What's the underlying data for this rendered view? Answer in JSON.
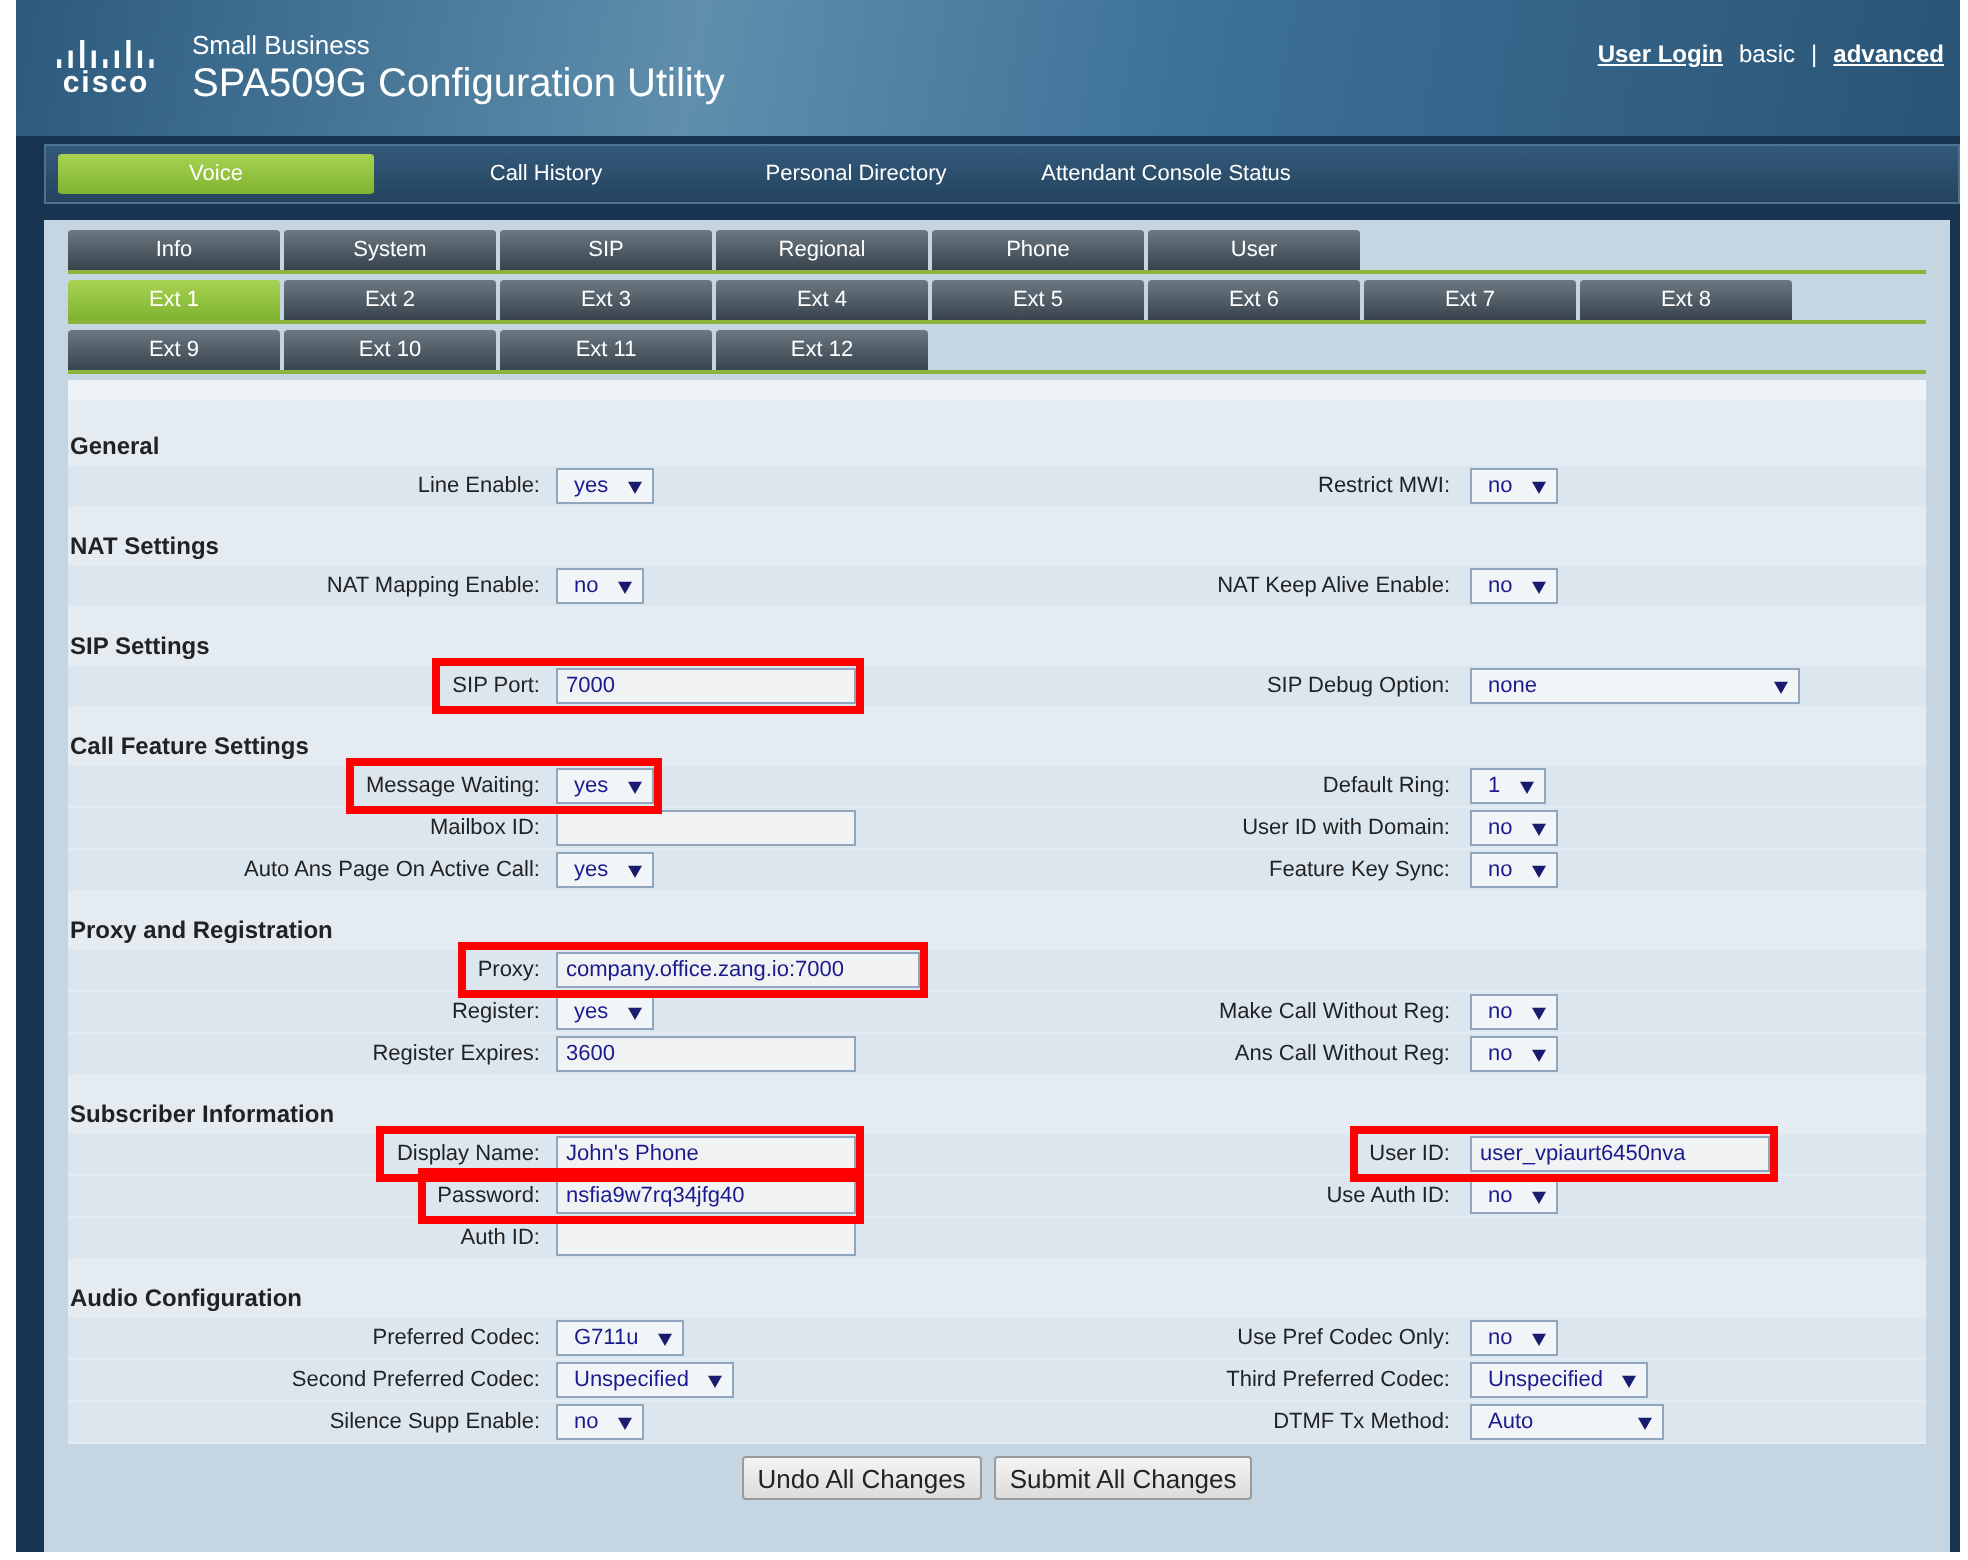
{
  "header": {
    "logo_text": "cisco",
    "brand": "Small Business",
    "title": "SPA509G Configuration Utility",
    "links": [
      {
        "kind": "link",
        "text": "User Login"
      },
      {
        "kind": "plain",
        "text": "basic"
      },
      {
        "kind": "separator",
        "text": "|"
      },
      {
        "kind": "link",
        "text": "advanced"
      }
    ]
  },
  "nav_tabs": [
    {
      "label": "Voice",
      "selected": true
    },
    {
      "label": "Call History",
      "selected": false
    },
    {
      "label": "Personal Directory",
      "selected": false
    },
    {
      "label": "Attendant Console Status",
      "selected": false
    }
  ],
  "tab_rows": [
    [
      {
        "label": "Info",
        "selected": false
      },
      {
        "label": "System",
        "selected": false
      },
      {
        "label": "SIP",
        "selected": false
      },
      {
        "label": "Regional",
        "selected": false
      },
      {
        "label": "Phone",
        "selected": false
      },
      {
        "label": "User",
        "selected": false
      }
    ],
    [
      {
        "label": "Ext 1",
        "selected": true
      },
      {
        "label": "Ext 2",
        "selected": false
      },
      {
        "label": "Ext 3",
        "selected": false
      },
      {
        "label": "Ext 4",
        "selected": false
      },
      {
        "label": "Ext 5",
        "selected": false
      },
      {
        "label": "Ext 6",
        "selected": false
      },
      {
        "label": "Ext 7",
        "selected": false
      },
      {
        "label": "Ext 8",
        "selected": false
      }
    ],
    [
      {
        "label": "Ext 9",
        "selected": false
      },
      {
        "label": "Ext 10",
        "selected": false
      },
      {
        "label": "Ext 11",
        "selected": false
      },
      {
        "label": "Ext 12",
        "selected": false
      }
    ]
  ],
  "sections": [
    {
      "title": "General",
      "rows": [
        {
          "left": {
            "label": "Line Enable:",
            "kind": "select",
            "value": "yes",
            "highlighted": false
          },
          "right": {
            "label": "Restrict MWI:",
            "kind": "select",
            "value": "no",
            "highlighted": false
          }
        }
      ]
    },
    {
      "title": "NAT Settings",
      "rows": [
        {
          "left": {
            "label": "NAT Mapping Enable:",
            "kind": "select",
            "value": "no",
            "highlighted": false
          },
          "right": {
            "label": "NAT Keep Alive Enable:",
            "kind": "select",
            "value": "no",
            "highlighted": false
          }
        }
      ]
    },
    {
      "title": "SIP Settings",
      "rows": [
        {
          "left": {
            "label": "SIP Port:",
            "kind": "text",
            "value": "7000",
            "highlighted": true
          },
          "right": {
            "label": "SIP Debug Option:",
            "kind": "wide-select",
            "value": "none",
            "highlighted": false
          }
        }
      ]
    },
    {
      "title": "Call Feature Settings",
      "rows": [
        {
          "left": {
            "label": "Message Waiting:",
            "kind": "select",
            "value": "yes",
            "highlighted": true
          },
          "right": {
            "label": "Default Ring:",
            "kind": "select",
            "value": "1",
            "highlighted": false
          }
        },
        {
          "left": {
            "label": "Mailbox ID:",
            "kind": "text",
            "highlighted": false
          },
          "right": {
            "label": "User ID with Domain:",
            "kind": "select",
            "value": "no",
            "highlighted": false
          }
        },
        {
          "left": {
            "label": "Auto Ans Page On Active Call:",
            "kind": "select",
            "value": "yes",
            "highlighted": false
          },
          "right": {
            "label": "Feature Key Sync:",
            "kind": "select",
            "value": "no",
            "highlighted": false
          }
        }
      ]
    },
    {
      "title": "Proxy and Registration",
      "rows": [
        {
          "left": {
            "label": "Proxy:",
            "kind": "long-text",
            "value": "company.office.zang.io:7000",
            "highlighted": true
          }
        },
        {
          "left": {
            "label": "Register:",
            "kind": "select",
            "value": "yes",
            "highlighted": false
          },
          "right": {
            "label": "Make Call Without Reg:",
            "kind": "select",
            "value": "no",
            "highlighted": false
          }
        },
        {
          "left": {
            "label": "Register Expires:",
            "kind": "text",
            "value": "3600",
            "highlighted": false
          },
          "right": {
            "label": "Ans Call Without Reg:",
            "kind": "select",
            "value": "no",
            "highlighted": false
          }
        }
      ]
    },
    {
      "title": "Subscriber Information",
      "rows": [
        {
          "left": {
            "label": "Display Name:",
            "kind": "text",
            "value": "John's Phone",
            "highlighted": true
          },
          "right": {
            "label": "User ID:",
            "kind": "text",
            "value": "user_vpiaurt6450nva",
            "highlighted": true
          }
        },
        {
          "left": {
            "label": "Password:",
            "kind": "text",
            "value": "nsfia9w7rq34jfg40",
            "highlighted": true
          },
          "right": {
            "label": "Use Auth ID:",
            "kind": "select",
            "value": "no",
            "highlighted": false
          }
        },
        {
          "left": {
            "label": "Auth ID:",
            "kind": "text",
            "highlighted": false
          }
        }
      ]
    },
    {
      "title": "Audio Configuration",
      "rows": [
        {
          "left": {
            "label": "Preferred Codec:",
            "kind": "select",
            "value": "G711u",
            "highlighted": false
          },
          "right": {
            "label": "Use Pref Codec Only:",
            "kind": "select",
            "value": "no",
            "highlighted": false
          }
        },
        {
          "left": {
            "label": "Second Preferred Codec:",
            "kind": "select",
            "value": "Unspecified",
            "highlighted": false
          },
          "right": {
            "label": "Third Preferred Codec:",
            "kind": "select",
            "value": "Unspecified",
            "highlighted": false
          }
        },
        {
          "left": {
            "label": "Silence Supp Enable:",
            "kind": "select",
            "value": "no",
            "highlighted": false
          },
          "right": {
            "label": "DTMF Tx Method:",
            "kind": "medium-select",
            "value": "Auto",
            "highlighted": false
          }
        }
      ]
    }
  ],
  "buttons": [
    "Undo All Changes",
    "Submit All Changes"
  ]
}
